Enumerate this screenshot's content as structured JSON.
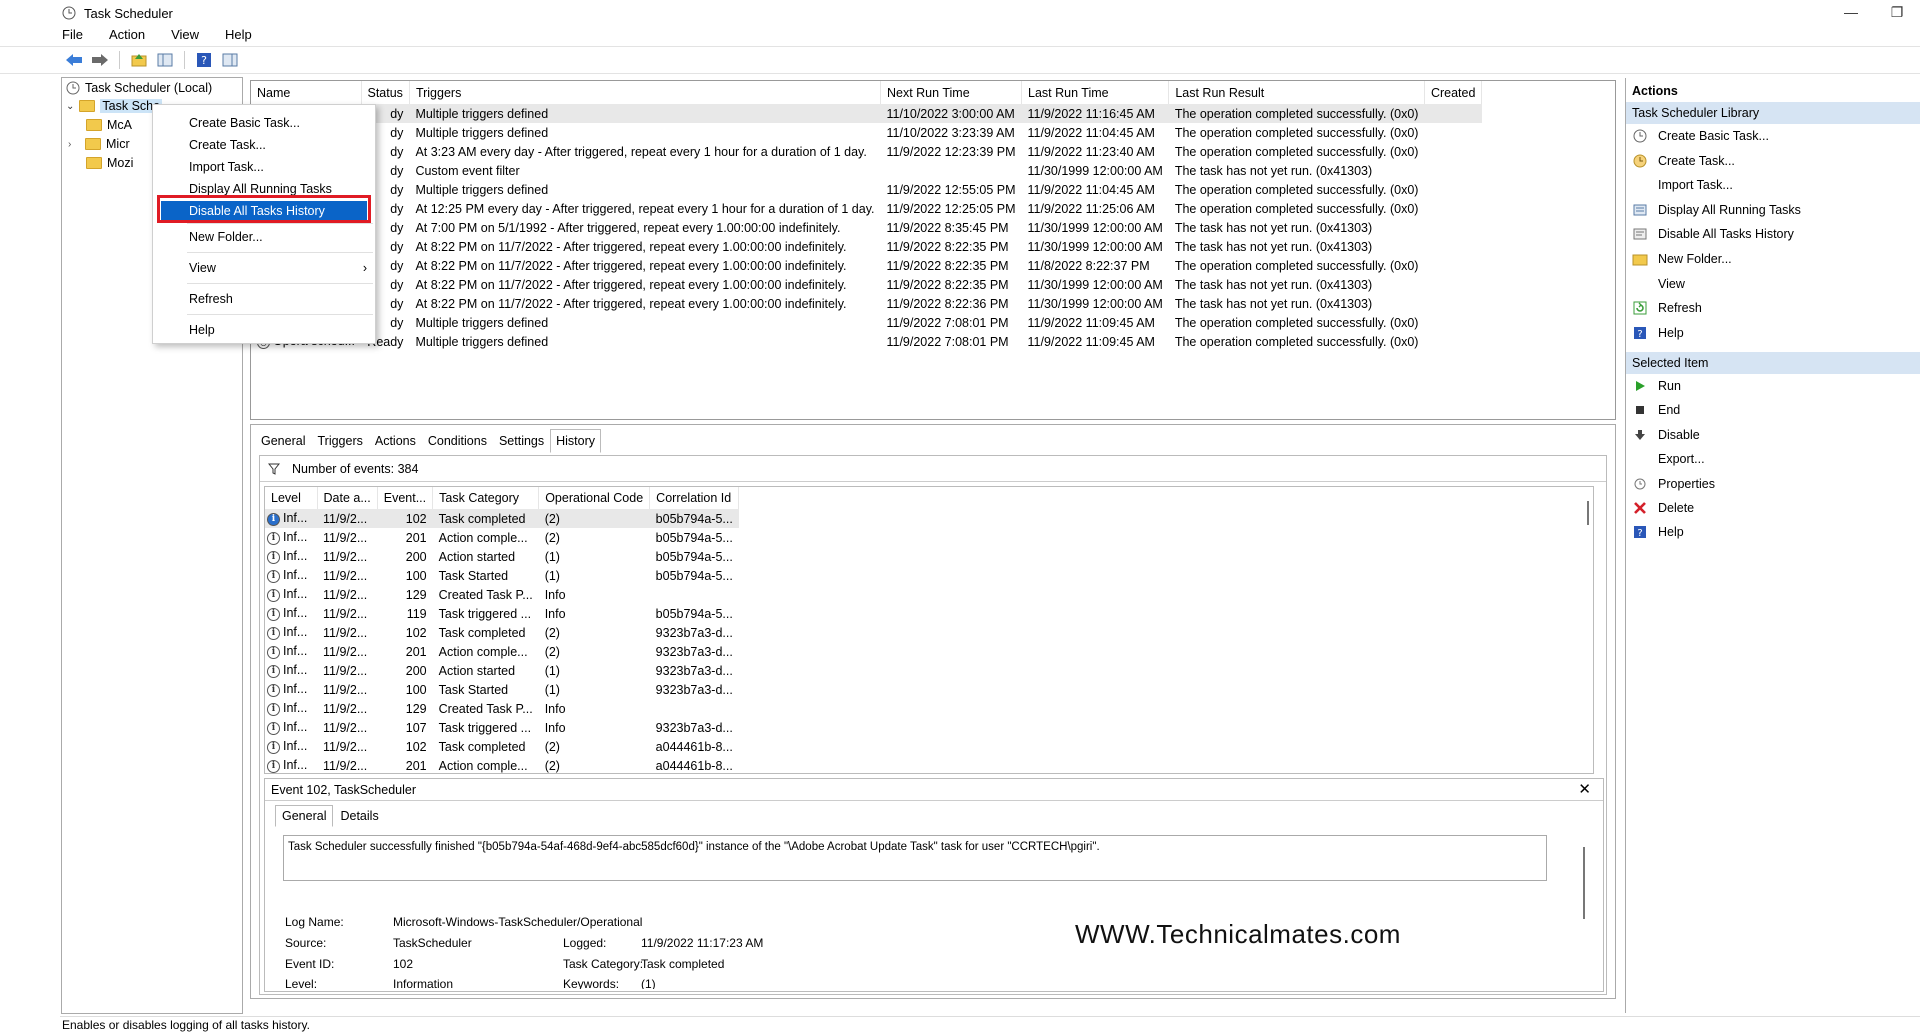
{
  "window": {
    "title": "Task Scheduler",
    "minimize": "—",
    "restore": "❐"
  },
  "menu": [
    "File",
    "Action",
    "View",
    "Help"
  ],
  "tree": {
    "root": "Task Scheduler (Local)",
    "library": "Task Sche",
    "children": [
      "McA",
      "Micr",
      "Mozi"
    ]
  },
  "context_menu": {
    "items": [
      "Create Basic Task...",
      "Create Task...",
      "Import Task...",
      "Display All Running Tasks",
      "Disable All Tasks History",
      "New Folder...",
      "View",
      "Refresh",
      "Help"
    ],
    "highlighted_index": 4
  },
  "tasklist": {
    "columns": [
      "Name",
      "Status",
      "Triggers",
      "Next Run Time",
      "Last Run Time",
      "Last Run Result",
      "Created"
    ],
    "rows": [
      {
        "name": "",
        "status": "dy",
        "triggers": "Multiple triggers defined",
        "next": "11/10/2022 3:00:00 AM",
        "last": "11/9/2022 11:16:45 AM",
        "result": "The operation completed successfully. (0x0)"
      },
      {
        "name": "",
        "status": "dy",
        "triggers": "Multiple triggers defined",
        "next": "11/10/2022 3:23:39 AM",
        "last": "11/9/2022 11:04:45 AM",
        "result": "The operation completed successfully. (0x0)"
      },
      {
        "name": "",
        "status": "dy",
        "triggers": "At 3:23 AM every day - After triggered, repeat every 1 hour for a duration of 1 day.",
        "next": "11/9/2022 12:23:39 PM",
        "last": "11/9/2022 11:23:40 AM",
        "result": "The operation completed successfully. (0x0)"
      },
      {
        "name": "",
        "status": "dy",
        "triggers": "Custom event filter",
        "next": "",
        "last": "11/30/1999 12:00:00 AM",
        "result": "The task has not yet run. (0x41303)"
      },
      {
        "name": "",
        "status": "dy",
        "triggers": "Multiple triggers defined",
        "next": "11/9/2022 12:55:05 PM",
        "last": "11/9/2022 11:04:45 AM",
        "result": "The operation completed successfully. (0x0)"
      },
      {
        "name": "",
        "status": "dy",
        "triggers": "At 12:25 PM every day - After triggered, repeat every 1 hour for a duration of 1 day.",
        "next": "11/9/2022 12:25:05 PM",
        "last": "11/9/2022 11:25:06 AM",
        "result": "The operation completed successfully. (0x0)"
      },
      {
        "name": "",
        "status": "dy",
        "triggers": "At 7:00 PM on 5/1/1992 - After triggered, repeat every 1.00:00:00 indefinitely.",
        "next": "11/9/2022 8:35:45 PM",
        "last": "11/30/1999 12:00:00 AM",
        "result": "The task has not yet run. (0x41303)"
      },
      {
        "name": "",
        "status": "dy",
        "triggers": "At 8:22 PM on 11/7/2022 - After triggered, repeat every 1.00:00:00 indefinitely.",
        "next": "11/9/2022 8:22:35 PM",
        "last": "11/30/1999 12:00:00 AM",
        "result": "The task has not yet run. (0x41303)"
      },
      {
        "name": "",
        "status": "dy",
        "triggers": "At 8:22 PM on 11/7/2022 - After triggered, repeat every 1.00:00:00 indefinitely.",
        "next": "11/9/2022 8:22:35 PM",
        "last": "11/8/2022 8:22:37 PM",
        "result": "The operation completed successfully. (0x0)"
      },
      {
        "name": "",
        "status": "dy",
        "triggers": "At 8:22 PM on 11/7/2022 - After triggered, repeat every 1.00:00:00 indefinitely.",
        "next": "11/9/2022 8:22:35 PM",
        "last": "11/30/1999 12:00:00 AM",
        "result": "The task has not yet run. (0x41303)"
      },
      {
        "name": "",
        "status": "dy",
        "triggers": "At 8:22 PM on 11/7/2022 - After triggered, repeat every 1.00:00:00 indefinitely.",
        "next": "11/9/2022 8:22:36 PM",
        "last": "11/30/1999 12:00:00 AM",
        "result": "The task has not yet run. (0x41303)"
      },
      {
        "name": "",
        "status": "dy",
        "triggers": "Multiple triggers defined",
        "next": "11/9/2022 7:08:01 PM",
        "last": "11/9/2022 11:09:45 AM",
        "result": "The operation completed successfully. (0x0)"
      },
      {
        "name": "Opera sched...",
        "status": "Ready",
        "triggers": "Multiple triggers defined",
        "next": "11/9/2022 7:08:01 PM",
        "last": "11/9/2022 11:09:45 AM",
        "result": "The operation completed successfully. (0x0)"
      }
    ]
  },
  "tabs": [
    "General",
    "Triggers",
    "Actions",
    "Conditions",
    "Settings",
    "History"
  ],
  "history": {
    "count_label": "Number of events: 384",
    "columns": [
      "Level",
      "Date a...",
      "Event...",
      "Task Category",
      "Operational Code",
      "Correlation Id"
    ],
    "rows": [
      [
        "Inf...",
        "11/9/2...",
        "102",
        "Task completed",
        "(2)",
        "b05b794a-5..."
      ],
      [
        "Inf...",
        "11/9/2...",
        "201",
        "Action comple...",
        "(2)",
        "b05b794a-5..."
      ],
      [
        "Inf...",
        "11/9/2...",
        "200",
        "Action started",
        "(1)",
        "b05b794a-5..."
      ],
      [
        "Inf...",
        "11/9/2...",
        "100",
        "Task Started",
        "(1)",
        "b05b794a-5..."
      ],
      [
        "Inf...",
        "11/9/2...",
        "129",
        "Created Task P...",
        "Info",
        ""
      ],
      [
        "Inf...",
        "11/9/2...",
        "119",
        "Task triggered ...",
        "Info",
        "b05b794a-5..."
      ],
      [
        "Inf...",
        "11/9/2...",
        "102",
        "Task completed",
        "(2)",
        "9323b7a3-d..."
      ],
      [
        "Inf...",
        "11/9/2...",
        "201",
        "Action comple...",
        "(2)",
        "9323b7a3-d..."
      ],
      [
        "Inf...",
        "11/9/2...",
        "200",
        "Action started",
        "(1)",
        "9323b7a3-d..."
      ],
      [
        "Inf...",
        "11/9/2...",
        "100",
        "Task Started",
        "(1)",
        "9323b7a3-d..."
      ],
      [
        "Inf...",
        "11/9/2...",
        "129",
        "Created Task P...",
        "Info",
        ""
      ],
      [
        "Inf...",
        "11/9/2...",
        "107",
        "Task triggered ...",
        "Info",
        "9323b7a3-d..."
      ],
      [
        "Inf...",
        "11/9/2...",
        "102",
        "Task completed",
        "(2)",
        "a044461b-8..."
      ],
      [
        "Inf...",
        "11/9/2...",
        "201",
        "Action comple...",
        "(2)",
        "a044461b-8..."
      ]
    ]
  },
  "event": {
    "title": "Event 102, TaskScheduler",
    "close": "✕",
    "tabs": [
      "General",
      "Details"
    ],
    "message": "Task Scheduler successfully finished \"{b05b794a-54af-468d-9ef4-abc585dcf60d}\" instance of the \"\\Adobe Acrobat Update Task\" task for user \"CCRTECH\\pgiri\".",
    "fields": {
      "log_name_label": "Log Name:",
      "log_name": "Microsoft-Windows-TaskScheduler/Operational",
      "source_label": "Source:",
      "source": "TaskScheduler",
      "logged_label": "Logged:",
      "logged": "11/9/2022 11:17:23 AM",
      "event_id_label": "Event ID:",
      "event_id": "102",
      "task_cat_label": "Task Category:",
      "task_cat": "Task completed",
      "level_label": "Level:",
      "level": "Information",
      "keywords_label": "Keywords:",
      "keywords": "(1)"
    }
  },
  "watermark": "WWW.Technicalmates.com",
  "actions": {
    "header": "Actions",
    "section1": "Task Scheduler Library",
    "items1": [
      "Create Basic Task...",
      "Create Task...",
      "Import Task...",
      "Display All Running Tasks",
      "Disable All Tasks History",
      "New Folder...",
      "View",
      "Refresh",
      "Help"
    ],
    "section2": "Selected Item",
    "items2": [
      "Run",
      "End",
      "Disable",
      "Export...",
      "Properties",
      "Delete",
      "Help"
    ]
  },
  "status": "Enables or disables logging of all tasks history.",
  "colors": {
    "selection": "#0a64c8",
    "highlight_box": "#e01b24",
    "section_bg": "#d6e4f3"
  }
}
